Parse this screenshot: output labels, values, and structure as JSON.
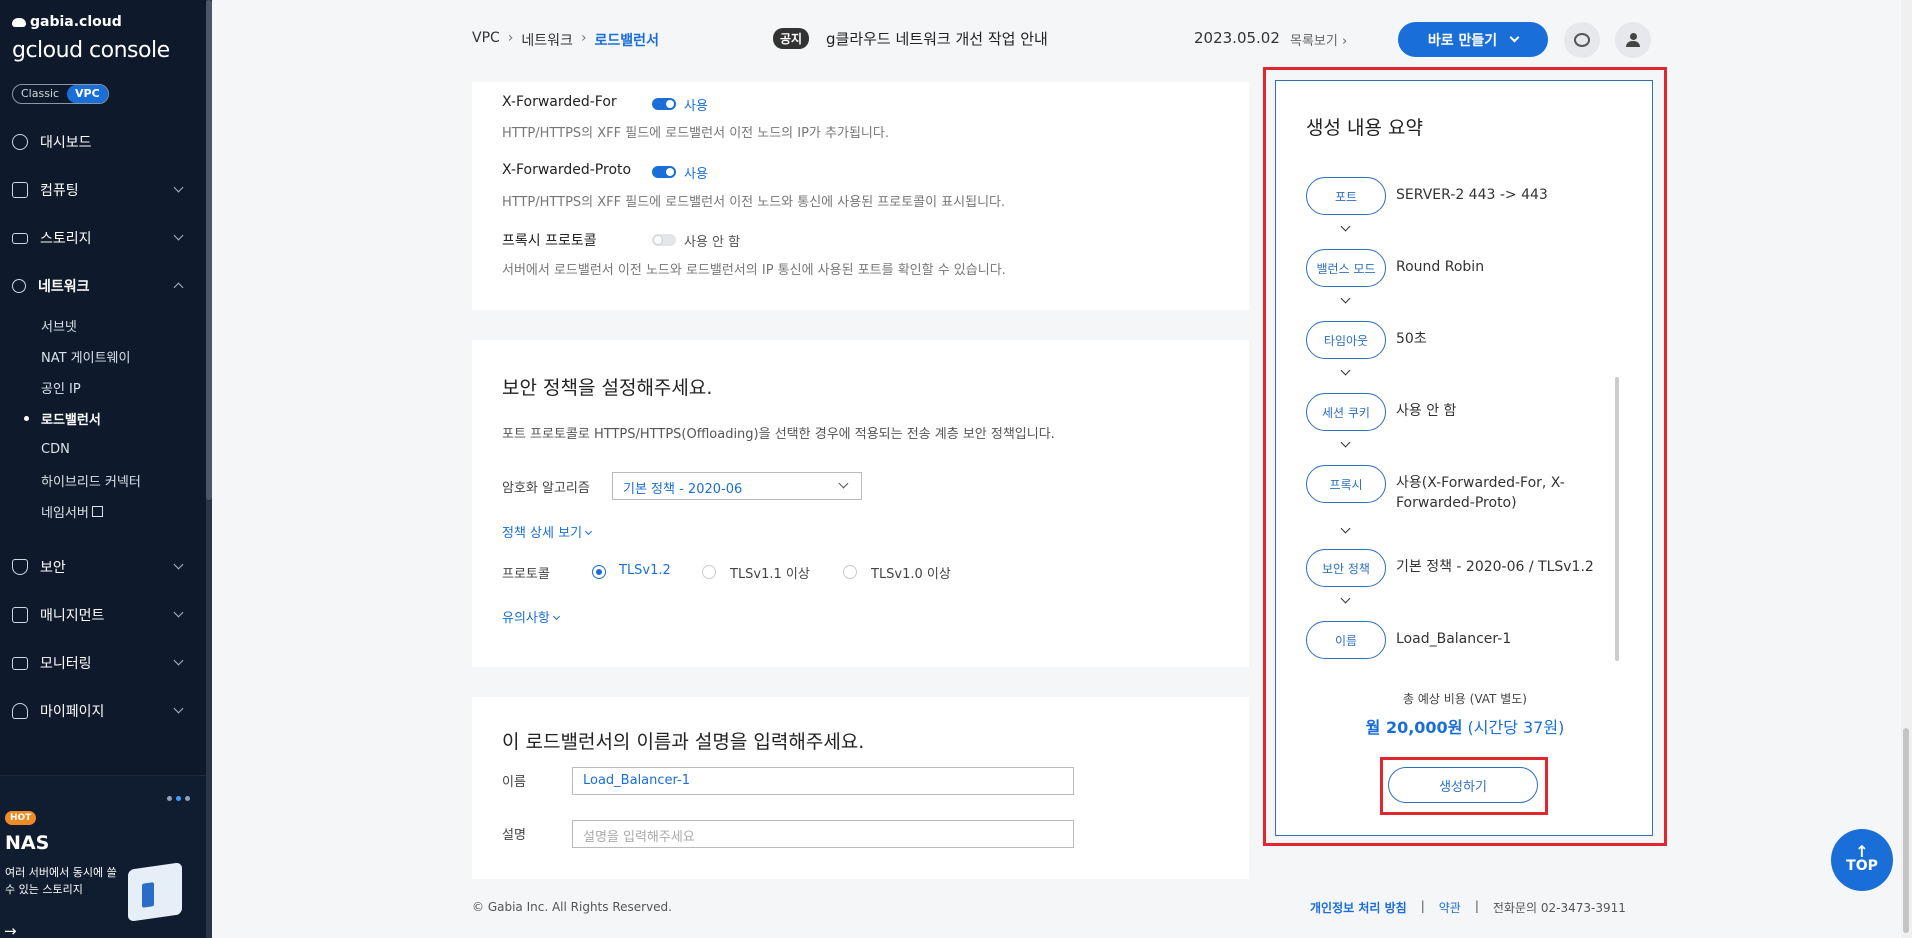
{
  "sidebar": {
    "brand_small": "gabia.cloud",
    "brand_main": "gcloud console",
    "toggle_classic": "Classic",
    "toggle_vpc": "VPC",
    "items": [
      {
        "label": "대시보드"
      },
      {
        "label": "컴퓨팅"
      },
      {
        "label": "스토리지"
      },
      {
        "label": "네트워크"
      },
      {
        "label": "보안"
      },
      {
        "label": "매니지먼트"
      },
      {
        "label": "모니터링"
      },
      {
        "label": "마이페이지"
      }
    ],
    "network_sub": [
      {
        "label": "서브넷"
      },
      {
        "label": "NAT 게이트웨이"
      },
      {
        "label": "공인 IP"
      },
      {
        "label": "로드밸런서"
      },
      {
        "label": "CDN"
      },
      {
        "label": "하이브리드 커넥터"
      },
      {
        "label": "네임서버"
      }
    ],
    "promo": {
      "badge": "HOT",
      "title": "NAS",
      "desc": "여러 서버에서 동시에 쓸 수 있는 스토리지",
      "arrow": "→"
    }
  },
  "header": {
    "breadcrumb": [
      "VPC",
      "네트워크",
      "로드밸런서"
    ],
    "breadcrumb_sep": "›",
    "notice_badge": "공지",
    "notice_text": "g클라우드 네트워크 개선 작업 안내",
    "notice_date": "2023.05.02",
    "notice_more": "목록보기 ›",
    "create_button": "바로 만들기"
  },
  "proxy": {
    "xff_label": "X-Forwarded-For",
    "xff_state": "사용",
    "xff_desc": "HTTP/HTTPS의 XFF 필드에 로드밸런서 이전 노드의 IP가 추가됩니다.",
    "xfp_label": "X-Forwarded-Proto",
    "xfp_state": "사용",
    "xfp_desc": "HTTP/HTTPS의 XFF 필드에 로드밸런서 이전 노드와 통신에 사용된 프로토콜이 표시됩니다.",
    "pp_label": "프록시 프로토콜",
    "pp_state": "사용 안 함",
    "pp_desc": "서버에서 로드밸런서 이전 노드와 로드밸런서의 IP 통신에 사용된 포트를 확인할 수 있습니다."
  },
  "security": {
    "title": "보안 정책을 설정해주세요.",
    "subtitle": "포트 프로토콜로 HTTPS/HTTPS(Offloading)을 선택한 경우에 적용되는 전송 계층 보안 정책입니다.",
    "algo_label": "암호화 알고리즘",
    "algo_value": "기본 정책 - 2020-06",
    "detail_link": "정책 상세 보기",
    "protocol_label": "프로토콜",
    "protocols": [
      {
        "label": "TLSv1.2",
        "selected": true
      },
      {
        "label": "TLSv1.1 이상",
        "selected": false
      },
      {
        "label": "TLSv1.0 이상",
        "selected": false
      }
    ],
    "caution_link": "유의사항"
  },
  "naming": {
    "title": "이 로드밸런서의 이름과 설명을 입력해주세요.",
    "name_label": "이름",
    "name_value": "Load_Balancer-1",
    "desc_label": "설명",
    "desc_placeholder": "설명을 입력해주세요"
  },
  "summary": {
    "title": "생성 내용 요약",
    "rows": [
      {
        "key": "포트",
        "value": "SERVER-2 443 -> 443"
      },
      {
        "key": "밸런스 모드",
        "value": "Round Robin"
      },
      {
        "key": "타임아웃",
        "value": "50초"
      },
      {
        "key": "세션 쿠키",
        "value": "사용 안 함"
      },
      {
        "key": "프록시",
        "value": "사용(X-Forwarded-For, X-Forwarded-Proto)"
      },
      {
        "key": "보안 정책",
        "value": "기본 정책 - 2020-06 / TLSv1.2"
      },
      {
        "key": "이름",
        "value": "Load_Balancer-1"
      }
    ],
    "cost_label": "총 예상 비용 (VAT 별도)",
    "cost_month": "월 20,000원",
    "cost_hour": "(시간당 37원)",
    "submit_button": "생성하기"
  },
  "footer": {
    "copyright": "© Gabia Inc. All Rights Reserved.",
    "privacy": "개인정보 처리 방침",
    "terms": "약관",
    "divider": "|",
    "contact": "전화문의 02-3473-3911"
  },
  "top_button": "TOP",
  "colors": {
    "sidebar_bg": "#0e1a2b",
    "accent": "#1a6ed8",
    "highlight_border": "#e0262f"
  }
}
